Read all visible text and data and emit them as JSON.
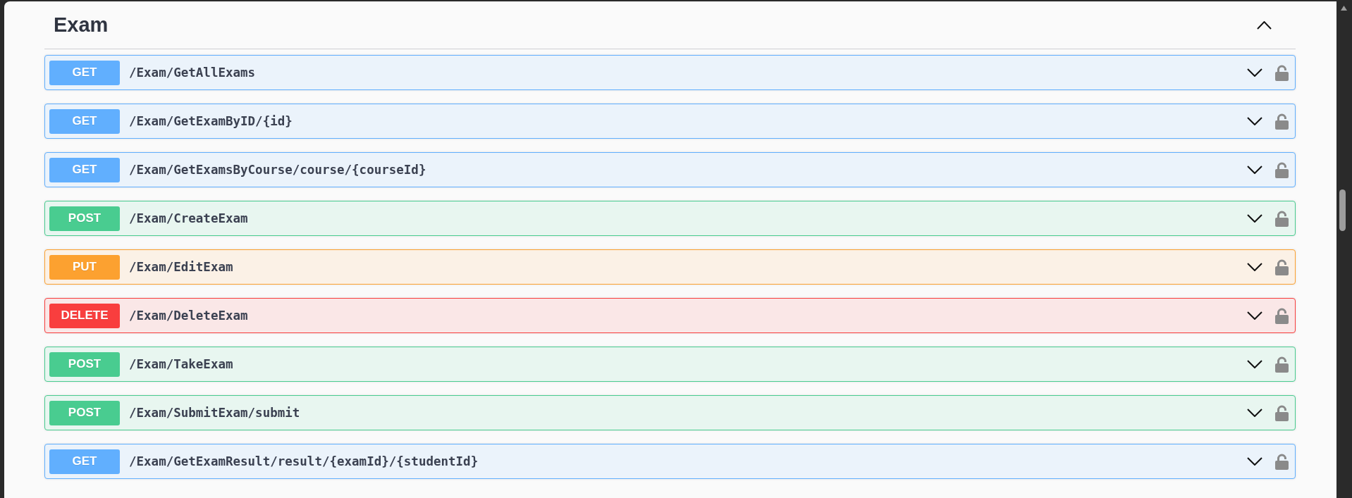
{
  "section": {
    "title": "Exam",
    "expanded": true
  },
  "endpoints": [
    {
      "kind": "get",
      "method": "GET",
      "path": "/Exam/GetAllExams",
      "expanded": false,
      "locked": false
    },
    {
      "kind": "get",
      "method": "GET",
      "path": "/Exam/GetExamByID/{id}",
      "expanded": false,
      "locked": false
    },
    {
      "kind": "get",
      "method": "GET",
      "path": "/Exam/GetExamsByCourse/course/{courseId}",
      "expanded": false,
      "locked": false
    },
    {
      "kind": "post",
      "method": "POST",
      "path": "/Exam/CreateExam",
      "expanded": false,
      "locked": false
    },
    {
      "kind": "put",
      "method": "PUT",
      "path": "/Exam/EditExam",
      "expanded": false,
      "locked": false
    },
    {
      "kind": "delete",
      "method": "DELETE",
      "path": "/Exam/DeleteExam",
      "expanded": false,
      "locked": false
    },
    {
      "kind": "post",
      "method": "POST",
      "path": "/Exam/TakeExam",
      "expanded": false,
      "locked": false
    },
    {
      "kind": "post",
      "method": "POST",
      "path": "/Exam/SubmitExam/submit",
      "expanded": false,
      "locked": false
    },
    {
      "kind": "get",
      "method": "GET",
      "path": "/Exam/GetExamResult/result/{examId}/{studentId}",
      "expanded": false,
      "locked": false
    }
  ]
}
